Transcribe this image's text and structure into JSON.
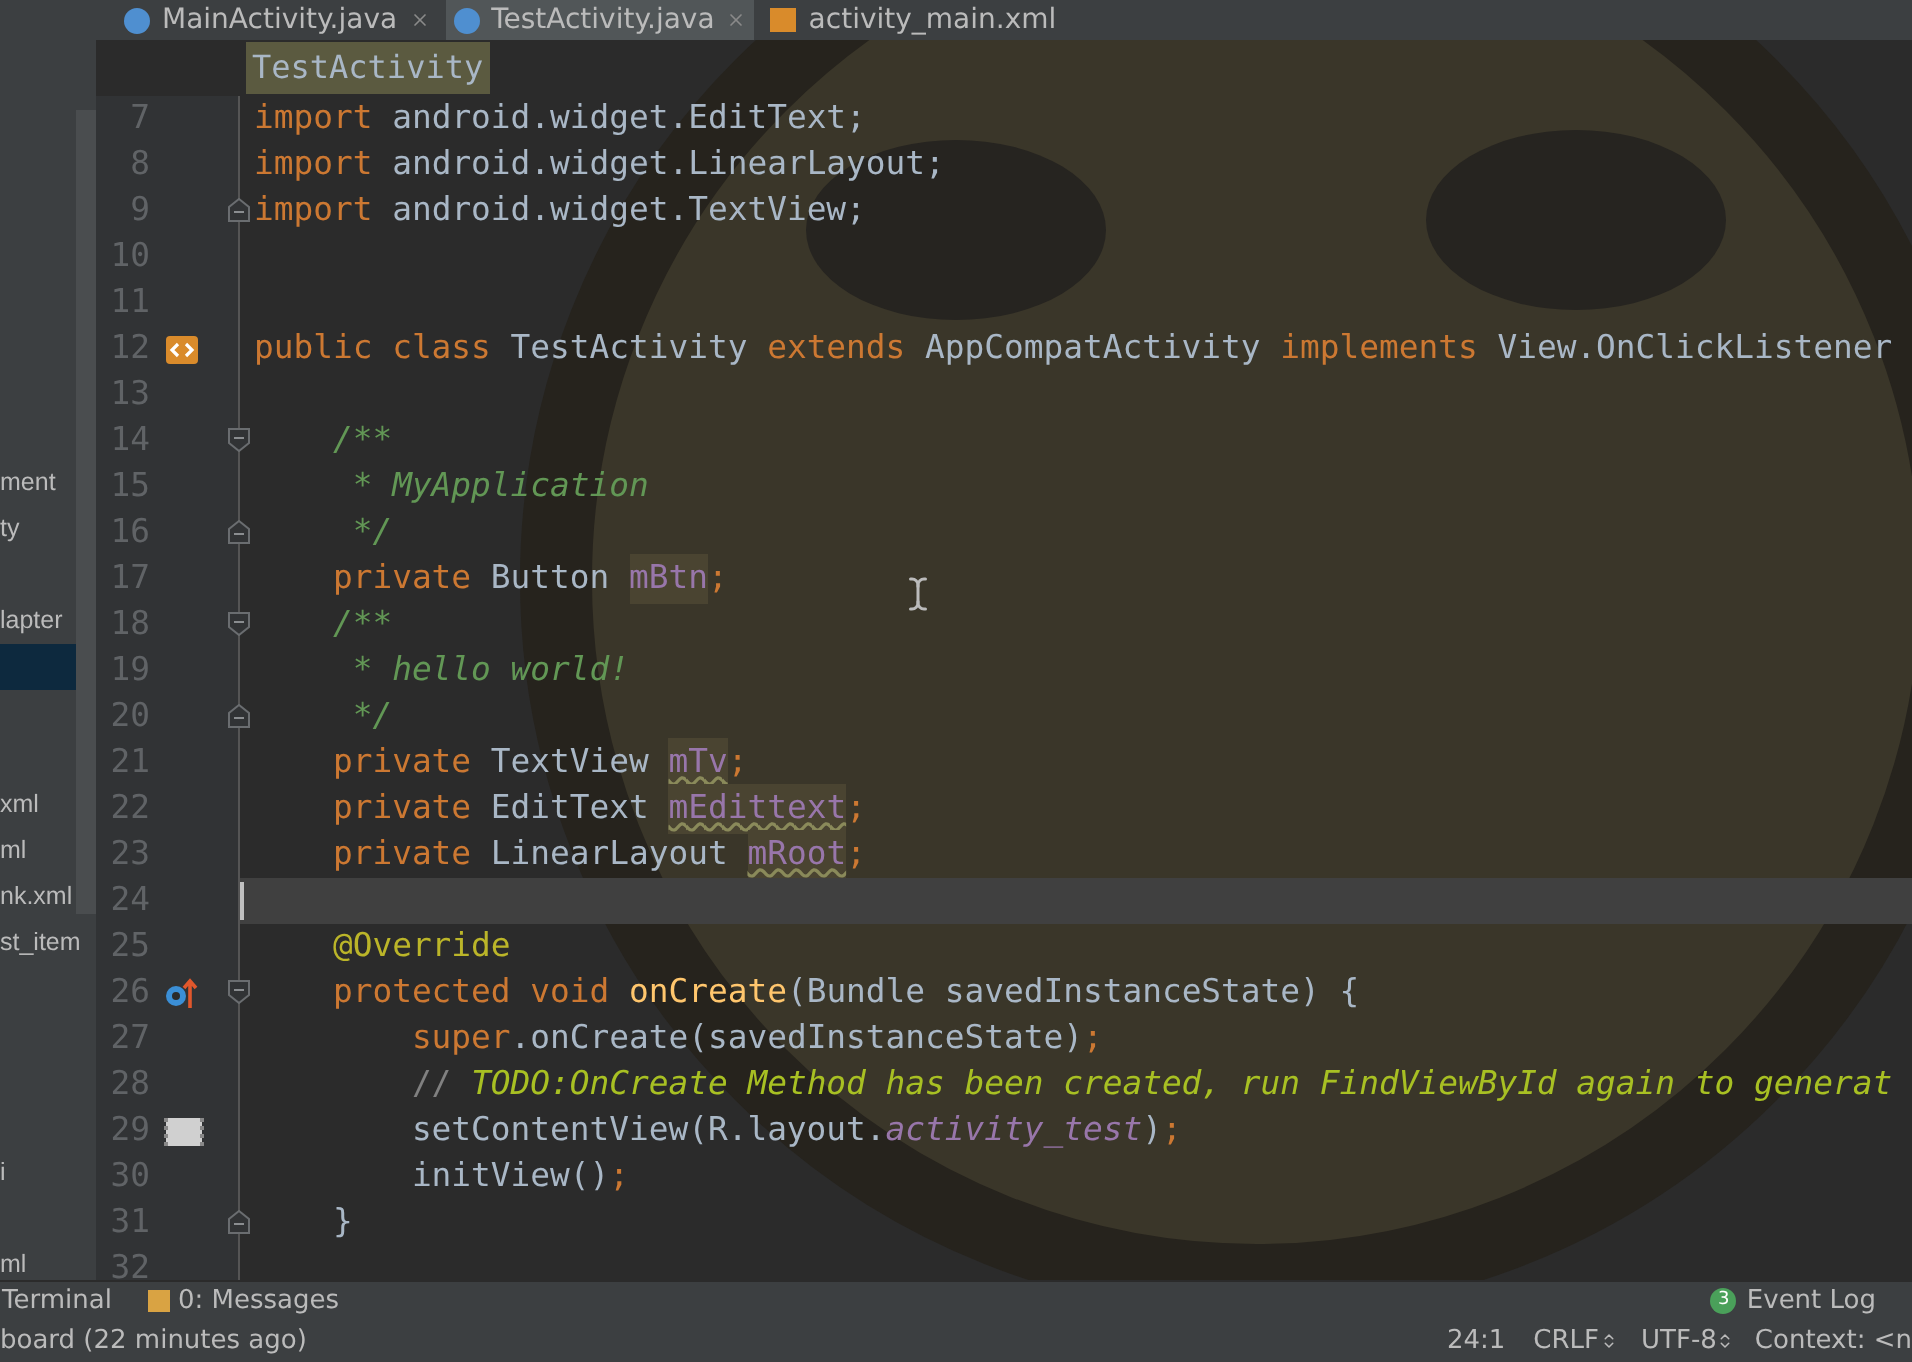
{
  "tabs": [
    {
      "label": "MainActivity.java",
      "kind": "java",
      "selected": false
    },
    {
      "label": "TestActivity.java",
      "kind": "java",
      "selected": true
    },
    {
      "label": "activity_main.xml",
      "kind": "xml",
      "selected": false
    }
  ],
  "breadcrumb": "TestActivity",
  "project_panel": {
    "rows": [
      {
        "kind": "item",
        "label": "ment",
        "selected": false
      },
      {
        "kind": "item",
        "label": "ty",
        "selected": false
      },
      {
        "kind": "blank"
      },
      {
        "kind": "item",
        "label": "lapter",
        "selected": false
      },
      {
        "kind": "item",
        "selected": true
      },
      {
        "kind": "blank"
      },
      {
        "kind": "blank"
      },
      {
        "kind": "item",
        "label": "xml",
        "selected": false
      },
      {
        "kind": "item",
        "label": "ml",
        "selected": false
      },
      {
        "kind": "item",
        "label": "nk.xml",
        "selected": false
      },
      {
        "kind": "item",
        "label": "st_item",
        "selected": false
      },
      {
        "kind": "blank"
      },
      {
        "kind": "blank"
      },
      {
        "kind": "blank"
      },
      {
        "kind": "blank"
      },
      {
        "kind": "item",
        "label": "i",
        "selected": false
      },
      {
        "kind": "blank"
      },
      {
        "kind": "item",
        "label": "ml",
        "selected": false
      }
    ]
  },
  "editor": {
    "lines": [
      {
        "number": "7",
        "current": false,
        "tokens": [
          {
            "kind": "keyword",
            "text": "import"
          },
          {
            "kind": "plain",
            "text": " android.widget.EditText;"
          }
        ]
      },
      {
        "number": "8",
        "current": false,
        "tokens": [
          {
            "kind": "keyword",
            "text": "import"
          },
          {
            "kind": "plain",
            "text": " android.widget.LinearLayout;"
          }
        ]
      },
      {
        "number": "9",
        "current": false,
        "fold_marker": {
          "kind": "end"
        },
        "tokens": [
          {
            "kind": "keyword",
            "text": "import"
          },
          {
            "kind": "plain",
            "text": " android.widget.TextView;"
          }
        ]
      },
      {
        "number": "10",
        "current": false
      },
      {
        "number": "11",
        "current": false
      },
      {
        "number": "12",
        "current": false,
        "gutter_icon": {
          "kind": "class"
        },
        "tokens": [
          {
            "kind": "keyword",
            "text": "public class"
          },
          {
            "kind": "plain",
            "text": " TestActivity "
          },
          {
            "kind": "keyword",
            "text": "extends"
          },
          {
            "kind": "plain",
            "text": " AppCompatActivity "
          },
          {
            "kind": "keyword",
            "text": "implements"
          },
          {
            "kind": "plain",
            "text": " View.OnClickListener"
          }
        ]
      },
      {
        "number": "13",
        "current": false
      },
      {
        "number": "14",
        "current": false,
        "fold_marker": {
          "kind": "start"
        },
        "tokens": [
          {
            "kind": "doc",
            "text": "    /**"
          }
        ]
      },
      {
        "number": "15",
        "current": false,
        "tokens": [
          {
            "kind": "doc",
            "text": "     * MyApplication"
          }
        ]
      },
      {
        "number": "16",
        "current": false,
        "fold_marker": {
          "kind": "end"
        },
        "tokens": [
          {
            "kind": "doc",
            "text": "     */"
          }
        ]
      },
      {
        "number": "17",
        "current": false,
        "tokens": [
          {
            "kind": "keyword",
            "text": "    private"
          },
          {
            "kind": "plain",
            "text": " Button "
          },
          {
            "kind": "field",
            "text": "mBtn"
          },
          {
            "kind": "keyword",
            "text": ";"
          }
        ]
      },
      {
        "number": "18",
        "current": false,
        "fold_marker": {
          "kind": "start"
        },
        "tokens": [
          {
            "kind": "doc",
            "text": "    /**"
          }
        ]
      },
      {
        "number": "19",
        "current": false,
        "tokens": [
          {
            "kind": "doc",
            "text": "     * hello world!"
          }
        ]
      },
      {
        "number": "20",
        "current": false,
        "fold_marker": {
          "kind": "end"
        },
        "tokens": [
          {
            "kind": "doc",
            "text": "     */"
          }
        ]
      },
      {
        "number": "21",
        "current": false,
        "tokens": [
          {
            "kind": "keyword",
            "text": "    private"
          },
          {
            "kind": "plain",
            "text": " TextView "
          },
          {
            "kind": "field-unused",
            "text": "mTv"
          },
          {
            "kind": "keyword",
            "text": ";"
          }
        ]
      },
      {
        "number": "22",
        "current": false,
        "tokens": [
          {
            "kind": "keyword",
            "text": "    private"
          },
          {
            "kind": "plain",
            "text": " EditText "
          },
          {
            "kind": "field-unused",
            "text": "mEdittext"
          },
          {
            "kind": "keyword",
            "text": ";"
          }
        ]
      },
      {
        "number": "23",
        "current": false,
        "tokens": [
          {
            "kind": "keyword",
            "text": "    private"
          },
          {
            "kind": "plain",
            "text": " LinearLayout "
          },
          {
            "kind": "field-unused",
            "text": "mRoot"
          },
          {
            "kind": "keyword",
            "text": ";"
          }
        ]
      },
      {
        "number": "24",
        "current": true
      },
      {
        "number": "25",
        "current": false,
        "tokens": [
          {
            "kind": "annotation",
            "text": "    @Override"
          }
        ]
      },
      {
        "number": "26",
        "current": false,
        "gutter_icon": {
          "kind": "override"
        },
        "fold_marker": {
          "kind": "start"
        },
        "tokens": [
          {
            "kind": "keyword",
            "text": "    protected void "
          },
          {
            "kind": "method",
            "text": "onCreate"
          },
          {
            "kind": "plain",
            "text": "(Bundle savedInstanceState) {"
          }
        ]
      },
      {
        "number": "27",
        "current": false,
        "tokens": [
          {
            "kind": "keyword",
            "text": "        super"
          },
          {
            "kind": "plain",
            "text": ".onCreate(savedInstanceState)"
          },
          {
            "kind": "keyword",
            "text": ";"
          }
        ]
      },
      {
        "number": "28",
        "current": false,
        "tokens": [
          {
            "kind": "comment",
            "text": "        // "
          },
          {
            "kind": "todo",
            "text": "TODO:OnCreate Method has been created, run FindViewById again to generat"
          }
        ]
      },
      {
        "number": "29",
        "current": false,
        "gutter_icon": {
          "kind": "layout"
        },
        "tokens": [
          {
            "kind": "plain",
            "text": "        setContentView(R.layout."
          },
          {
            "kind": "static",
            "text": "activity_test"
          },
          {
            "kind": "plain",
            "text": ")"
          },
          {
            "kind": "keyword",
            "text": ";"
          }
        ]
      },
      {
        "number": "30",
        "current": false,
        "tokens": [
          {
            "kind": "plain",
            "text": "        initView()"
          },
          {
            "kind": "keyword",
            "text": ";"
          }
        ]
      },
      {
        "number": "31",
        "current": false,
        "fold_marker": {
          "kind": "end"
        },
        "tokens": [
          {
            "kind": "plain",
            "text": "    }"
          }
        ]
      },
      {
        "number": "32",
        "current": false
      }
    ]
  },
  "tool_windows": [
    {
      "label": "Terminal",
      "kind": "terminal"
    },
    {
      "label": "0: Messages",
      "kind": "messages"
    }
  ],
  "event_log": {
    "label": "Event Log",
    "count": "3"
  },
  "status_bar": {
    "message": "board (22 minutes ago)",
    "position": "24:1",
    "line_separator": "CRLF",
    "encoding": "UTF-8",
    "context": "Context: <n"
  }
}
